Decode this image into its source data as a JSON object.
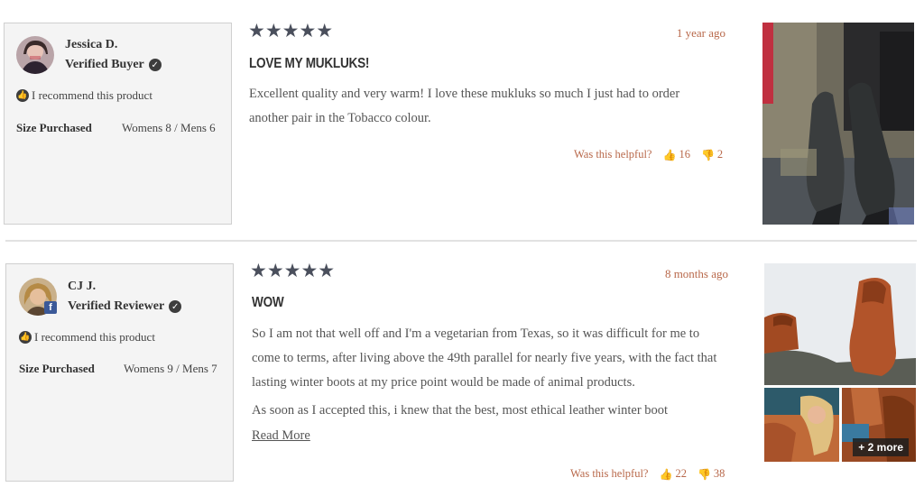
{
  "reviews": [
    {
      "author": "Jessica D.",
      "badge": "Verified Buyer",
      "recommend": "I recommend this product",
      "size_label": "Size Purchased",
      "size_value": "Womens 8 / Mens 6",
      "rating": 5,
      "stars": "★★★★★",
      "date": "1 year ago",
      "title": "LOVE MY MUKLUKS!",
      "body": [
        "Excellent quality and very warm! I love these mukluks so much I just had to order another pair in the Tobacco colour."
      ],
      "helpful_label": "Was this helpful?",
      "up_votes": "16",
      "down_votes": "2",
      "photos": 1
    },
    {
      "author": "CJ J.",
      "badge": "Verified Reviewer",
      "recommend": "I recommend this product",
      "size_label": "Size Purchased",
      "size_value": "Womens 9 / Mens 7",
      "rating": 5,
      "stars": "★★★★★",
      "date": "8 months ago",
      "title": "WOW",
      "body": [
        "So I am not that well off and I'm a vegetarian from Texas, so it was difficult for me to come to terms, after living above the 49th parallel for nearly five years, with the fact that lasting winter boots at my price point would be made of animal products.",
        "As soon as I accepted this, i knew that the best, most ethical leather winter boot"
      ],
      "read_more": "Read More",
      "helpful_label": "Was this helpful?",
      "up_votes": "22",
      "down_votes": "38",
      "more_photos": "+ 2 more",
      "fb_badge": "f"
    }
  ],
  "icons": {
    "verified": "check-circle-icon",
    "recommend": "thumbs-up-circle-icon",
    "thumb_up": "thumbs-up-icon",
    "thumb_down": "thumbs-down-icon",
    "facebook": "facebook-icon"
  },
  "colors": {
    "accent": "#b8684a",
    "stars": "#4a4f5c",
    "card_bg": "#f4f4f4"
  }
}
